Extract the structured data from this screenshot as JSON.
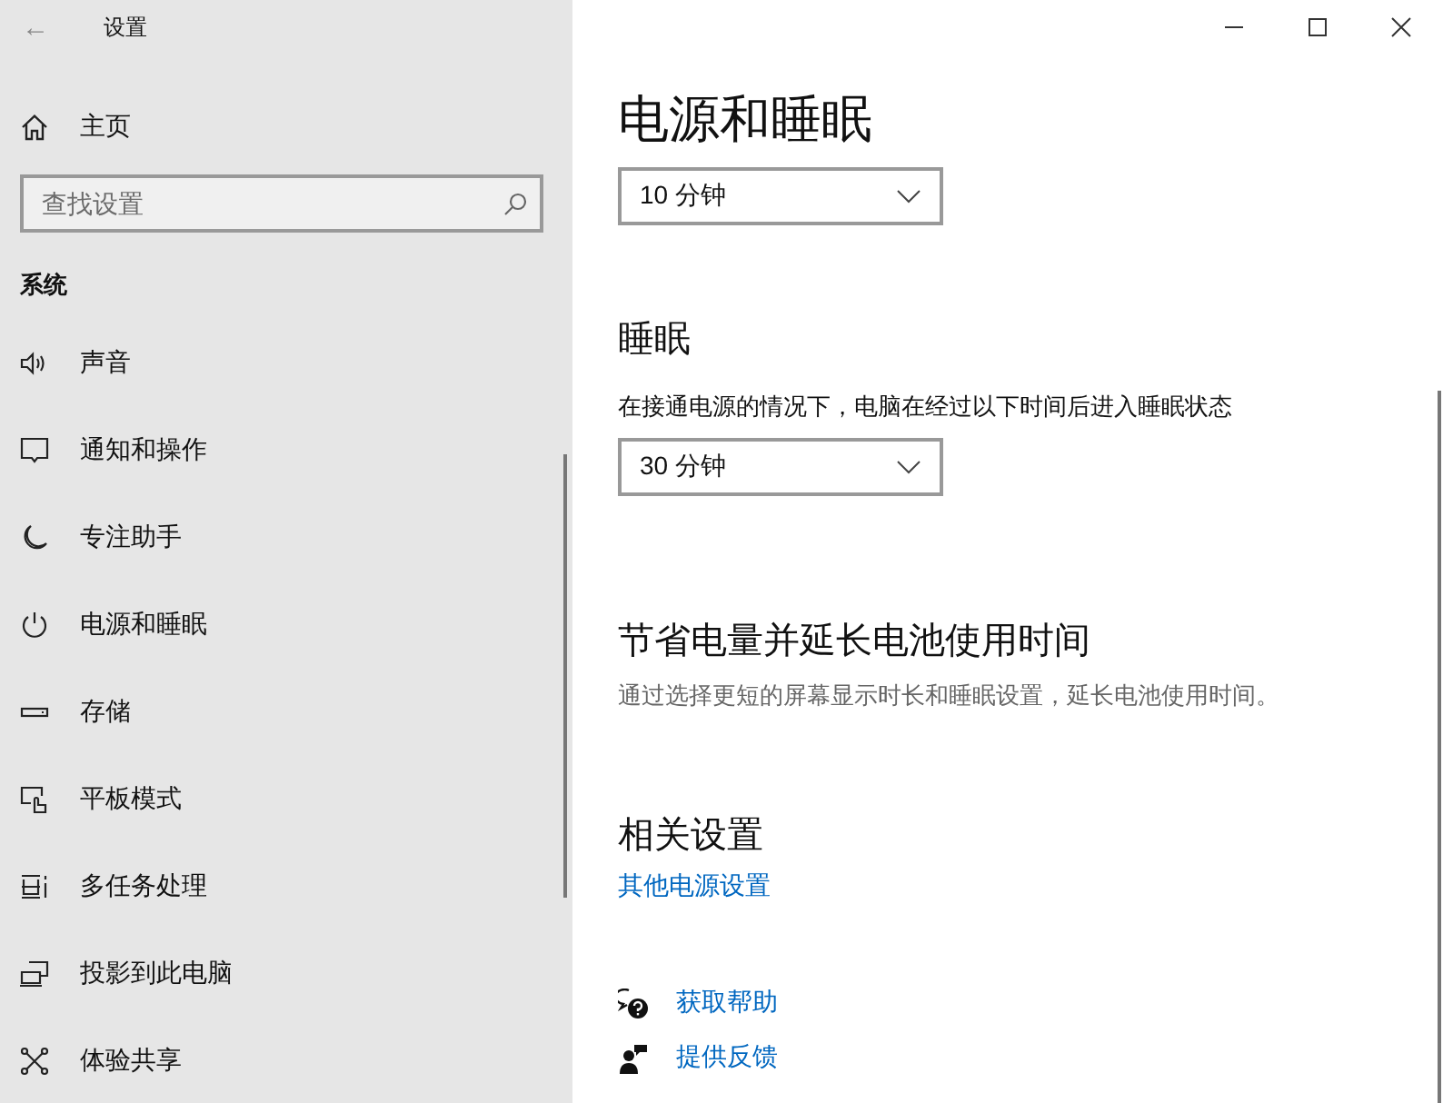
{
  "window": {
    "title": "设置",
    "back": "←"
  },
  "sidebar": {
    "home": "主页",
    "search": {
      "placeholder": "查找设置"
    },
    "section": "系统",
    "items": [
      {
        "label": "声音"
      },
      {
        "label": "通知和操作"
      },
      {
        "label": "专注助手"
      },
      {
        "label": "电源和睡眠"
      },
      {
        "label": "存储"
      },
      {
        "label": "平板模式"
      },
      {
        "label": "多任务处理"
      },
      {
        "label": "投影到此电脑"
      },
      {
        "label": "体验共享"
      }
    ]
  },
  "content": {
    "title": "电源和睡眠",
    "screen_dropdown": {
      "value": "10 分钟"
    },
    "sleep": {
      "heading": "睡眠",
      "label": "在接通电源的情况下，电脑在经过以下时间后进入睡眠状态",
      "dropdown": {
        "value": "30 分钟"
      }
    },
    "battery": {
      "heading": "节省电量并延长电池使用时间",
      "text": "通过选择更短的屏幕显示时长和睡眠设置，延长电池使用时间。"
    },
    "related": {
      "heading": "相关设置",
      "link": "其他电源设置"
    },
    "help_links": [
      "获取帮助",
      "提供反馈"
    ]
  }
}
